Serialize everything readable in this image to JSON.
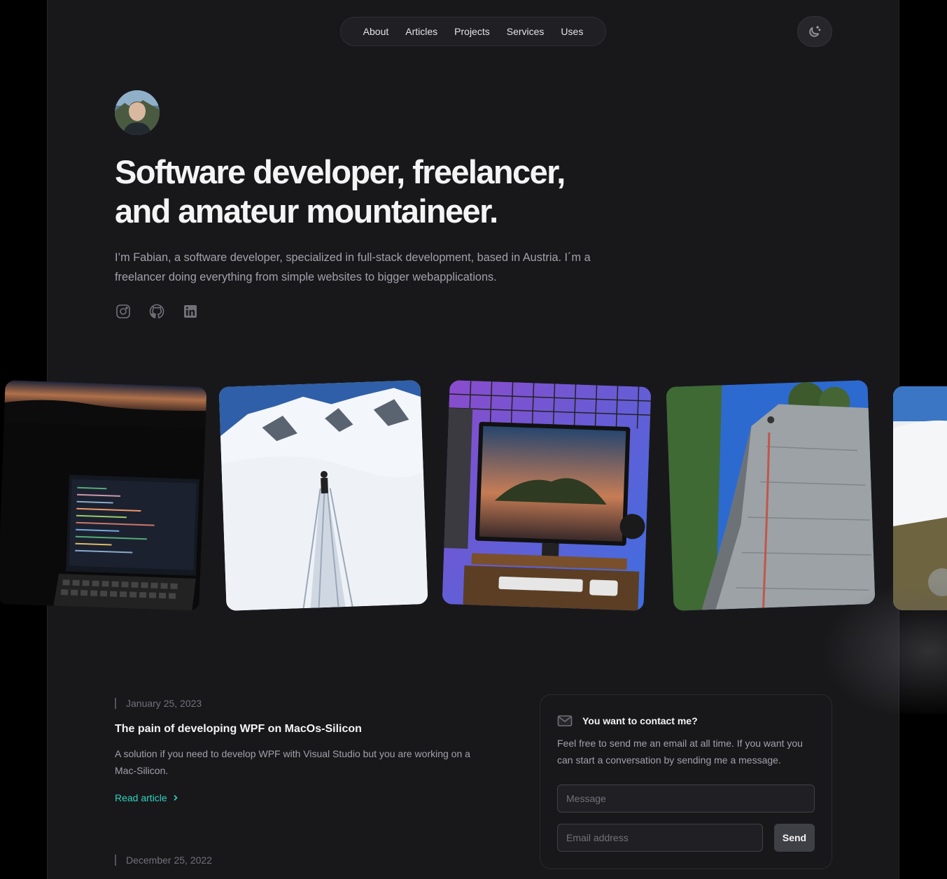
{
  "nav": {
    "items": [
      {
        "label": "About"
      },
      {
        "label": "Articles"
      },
      {
        "label": "Projects"
      },
      {
        "label": "Services"
      },
      {
        "label": "Uses"
      }
    ],
    "theme_toggle_icon": "moon-sparkle-icon"
  },
  "hero": {
    "headline": "Software developer, freelancer, and amateur mountaineer.",
    "intro": "I’m Fabian, a software developer, specialized in full-stack development, based in Austria. I´m a freelancer doing everything from simple websites to bigger webapplications.",
    "socials": [
      "instagram-icon",
      "github-icon",
      "linkedin-icon"
    ]
  },
  "photos": [
    {
      "subject": "laptop at sunset"
    },
    {
      "subject": "ski touring in snow"
    },
    {
      "subject": "desk setup with monitor"
    },
    {
      "subject": "rock climbing wall"
    },
    {
      "subject": "mountain above clouds"
    }
  ],
  "articles": [
    {
      "date": "January 25, 2023",
      "title": "The pain of developing WPF on MacOs-Silicon",
      "description": "A solution if you need to develop WPF with Visual Studio but you are working on a Mac-Silicon.",
      "link_label": "Read article"
    },
    {
      "date": "December 25, 2022"
    }
  ],
  "contact": {
    "title": "You want to contact me?",
    "text": "Feel free to send me an email at all time. If you want you can start a conversation by sending me a message.",
    "message_placeholder": "Message",
    "email_placeholder": "Email address",
    "send_label": "Send"
  },
  "colors": {
    "background": "#18181b",
    "accent": "#2dd4bf",
    "text_muted": "#a1a1aa"
  }
}
